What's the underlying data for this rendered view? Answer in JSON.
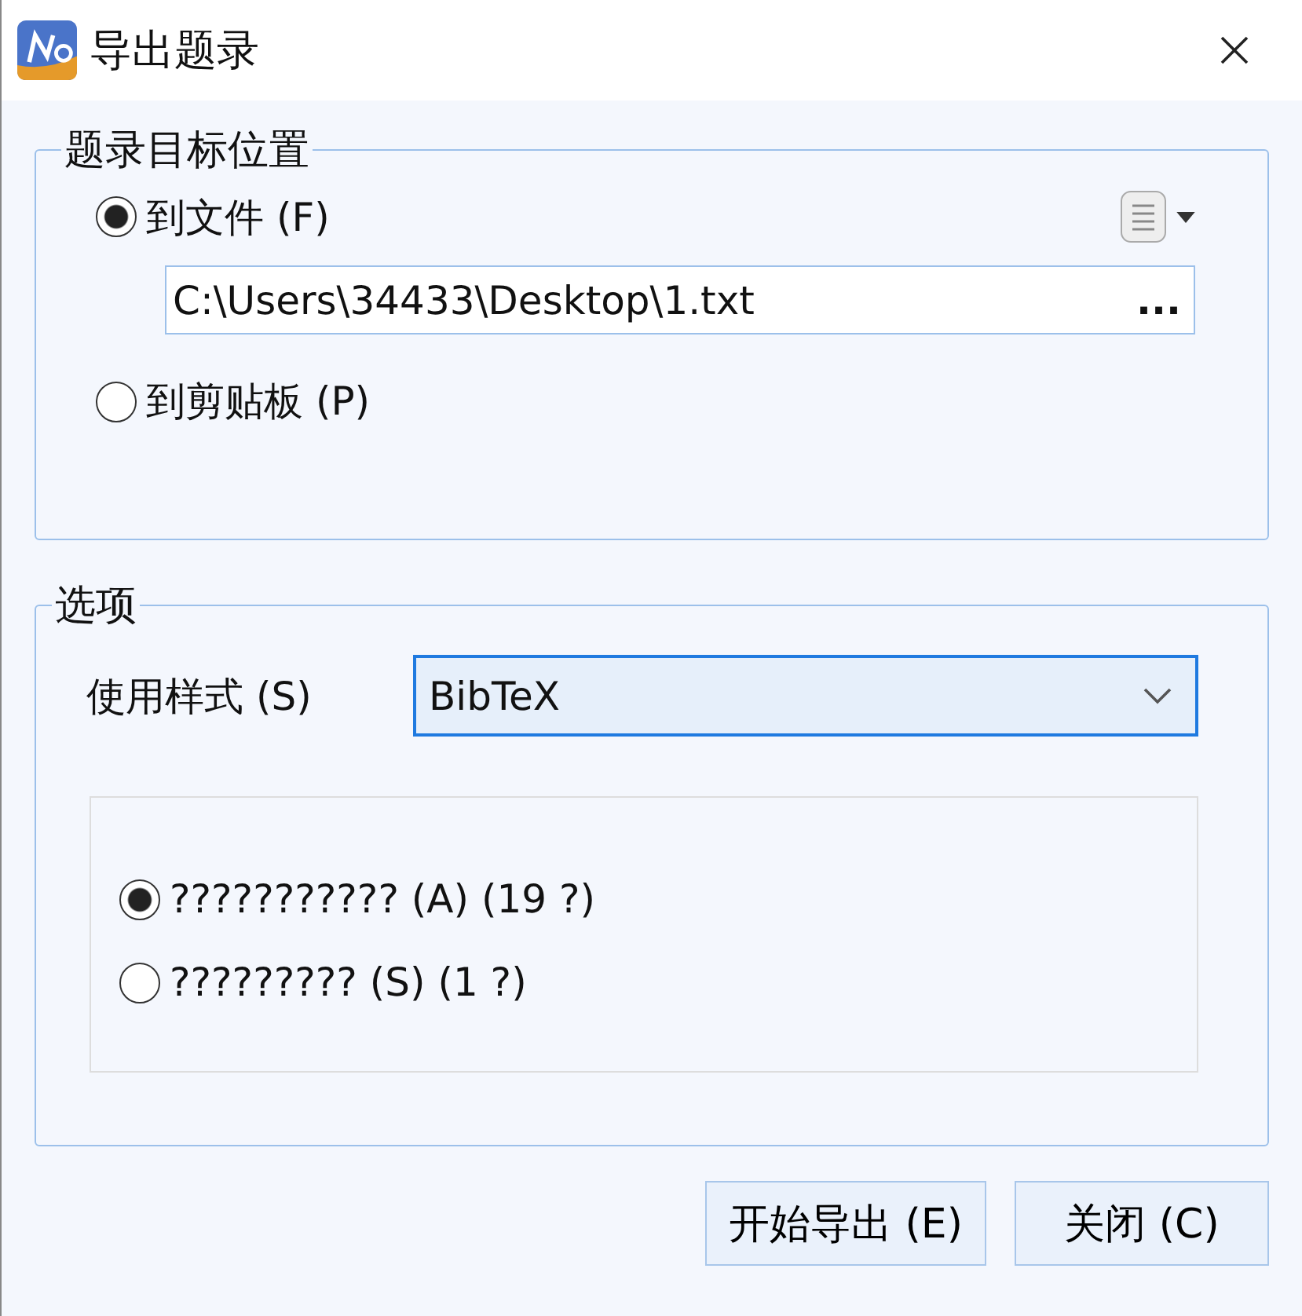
{
  "window": {
    "title": "导出题录"
  },
  "destination_group": {
    "title": "题录目标位置",
    "options": [
      {
        "label": "到文件 (F)",
        "selected": true
      },
      {
        "label": "到剪贴板 (P)",
        "selected": false
      }
    ],
    "file_path": {
      "value": "C:\\Users\\34433\\Desktop\\1.txt",
      "browse": "..."
    }
  },
  "options_group": {
    "title": "选项",
    "style_label": "使用样式 (S)",
    "style_value": "BibTeX",
    "scope_options": [
      {
        "label": "??????????? (A) (19 ?)",
        "selected": true
      },
      {
        "label": "????????? (S) (1 ?)",
        "selected": false
      }
    ]
  },
  "buttons": [
    "开始导出 (E)",
    "关闭 (C)"
  ]
}
